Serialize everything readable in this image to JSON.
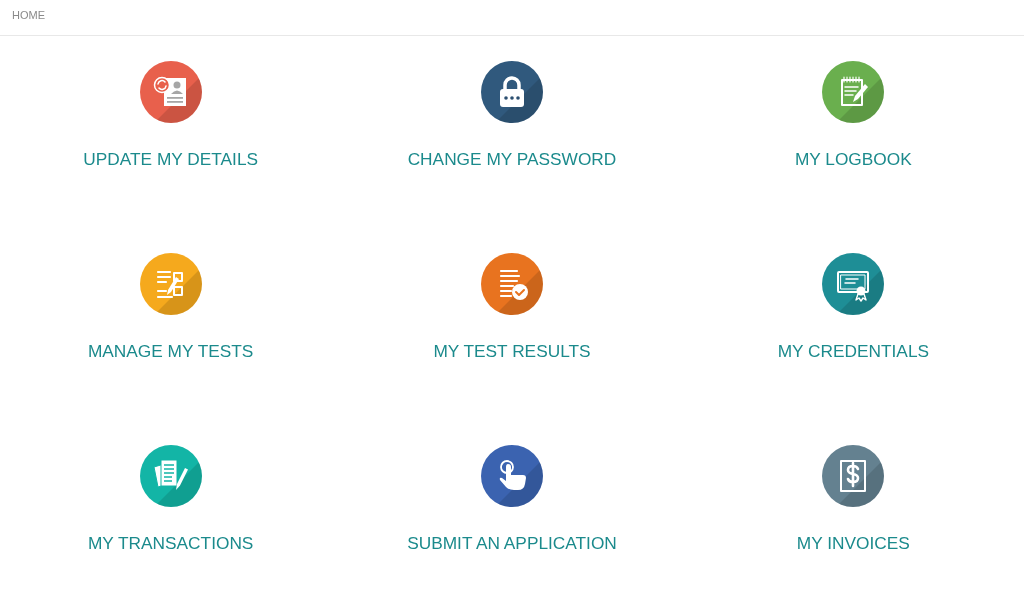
{
  "breadcrumb": {
    "label": "HOME"
  },
  "tiles": [
    {
      "label": "UPDATE MY DETAILS",
      "color": "#e8604c"
    },
    {
      "label": "CHANGE MY PASSWORD",
      "color": "#30597d"
    },
    {
      "label": "MY LOGBOOK",
      "color": "#6aaf4e"
    },
    {
      "label": "MANAGE MY TESTS",
      "color": "#f5a91d"
    },
    {
      "label": "MY TEST RESULTS",
      "color": "#e8731f"
    },
    {
      "label": "MY CREDENTIALS",
      "color": "#1e8e96"
    },
    {
      "label": "MY TRANSACTIONS",
      "color": "#13b5a6"
    },
    {
      "label": "SUBMIT AN APPLICATION",
      "color": "#3b63b0"
    },
    {
      "label": "MY INVOICES",
      "color": "#648190"
    }
  ]
}
